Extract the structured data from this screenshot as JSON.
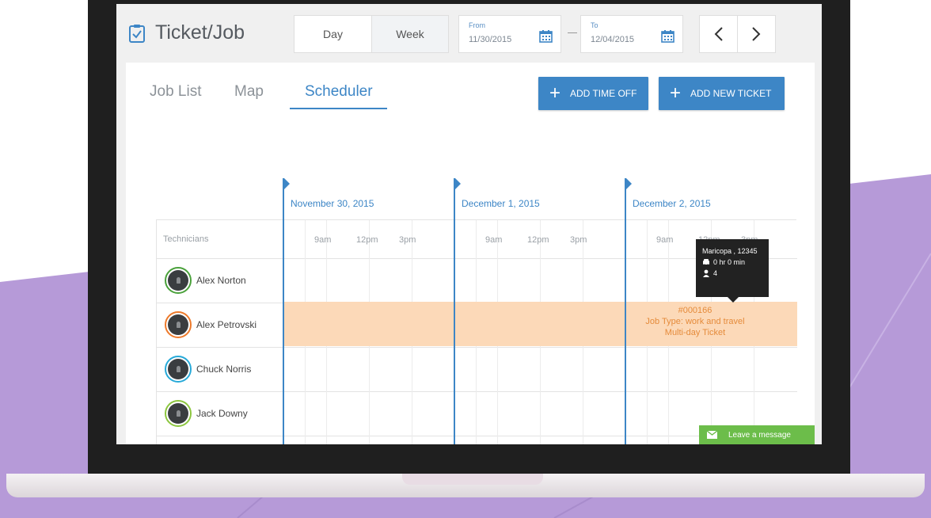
{
  "colors": {
    "accent": "#3d86c6",
    "job_bar": "#fcd9b8",
    "job_text": "#e58b3b",
    "chat_green": "#6cbd4a",
    "background_purple": "#b69ad8"
  },
  "header": {
    "title": "Ticket/Job",
    "icon": "clipboard-check-icon",
    "view_toggle": [
      "Day",
      "Week"
    ],
    "view_selected": "Week",
    "from": {
      "label": "From",
      "value": "11/30/2015",
      "icon": "calendar-icon"
    },
    "to": {
      "label": "To",
      "value": "12/04/2015",
      "icon": "calendar-icon"
    },
    "prev_icon": "chevron-left-icon",
    "next_icon": "chevron-right-icon",
    "dash": "—"
  },
  "tabs": [
    {
      "label": "Job List",
      "active": false
    },
    {
      "label": "Map",
      "active": false
    },
    {
      "label": "Scheduler",
      "active": true
    }
  ],
  "actions": {
    "add_time_off": "ADD TIME OFF",
    "add_new_ticket": "ADD NEW TICKET"
  },
  "scheduler": {
    "technicians_header": "Technicians",
    "days": [
      {
        "date": "November 30, 2015",
        "times": [
          "9am",
          "12pm",
          "3pm"
        ]
      },
      {
        "date": "December 1, 2015",
        "times": [
          "9am",
          "12pm",
          "3pm"
        ]
      },
      {
        "date": "December 2, 2015",
        "times": [
          "9am",
          "12pm",
          "3pm"
        ]
      }
    ],
    "technicians": [
      {
        "name": "Alex Norton",
        "ring": "#4aa13b"
      },
      {
        "name": "Alex Petrovski",
        "ring": "#ee7a2b"
      },
      {
        "name": "Chuck Norris",
        "ring": "#27a9d8"
      },
      {
        "name": "Jack Downy",
        "ring": "#8cc63f"
      }
    ],
    "job": {
      "id": "#000166",
      "type": "Job Type: work and travel",
      "note": "Multi-day Ticket"
    },
    "tooltip": {
      "location": "Maricopa , 12345",
      "drive": "0 hr 0 min",
      "people": "4"
    }
  },
  "chat": {
    "label": "Leave a message"
  }
}
